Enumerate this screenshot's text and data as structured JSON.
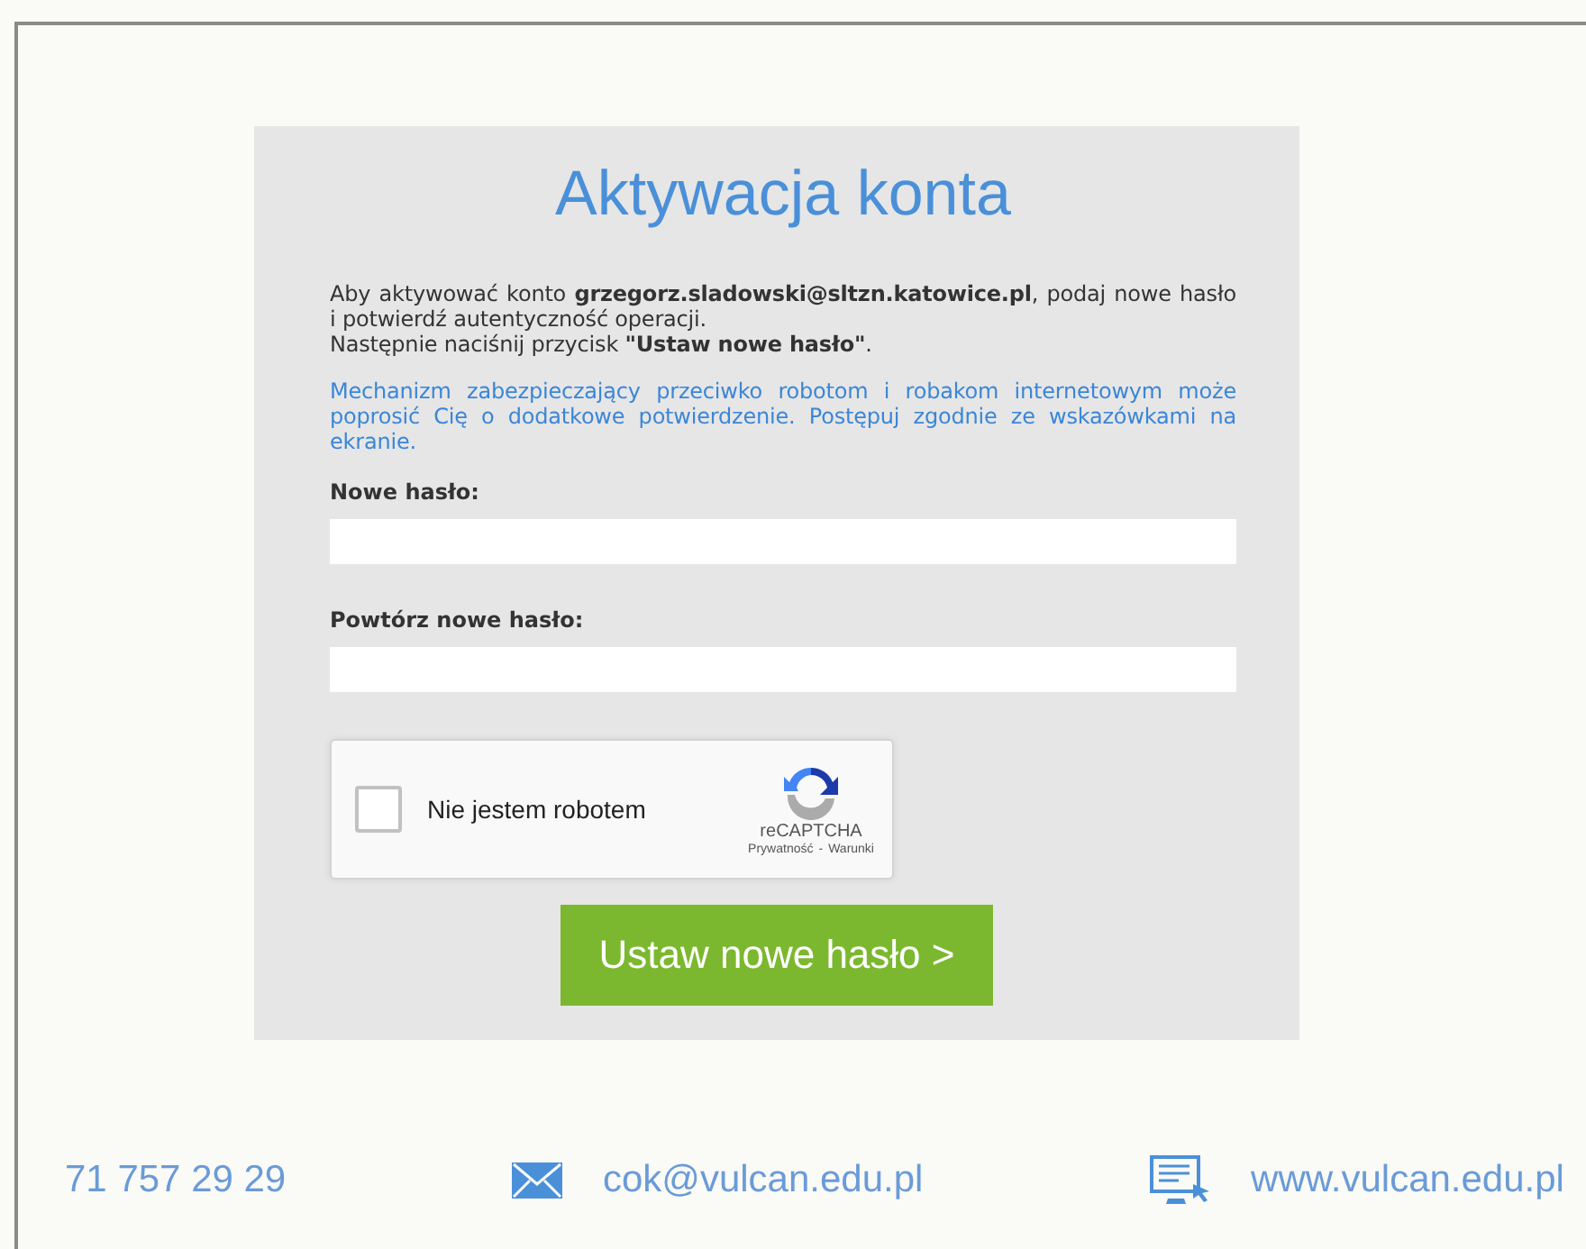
{
  "title": "Aktywacja konta",
  "intro": [
    "Aby aktywować konto **grzegorz.sladowski@sltzn.katowice.pl**, podaj nowe hasło i potwierdź autentyczność operacji.",
    "Następnie naciśnij przycisk **\"Ustaw nowe hasło\"**."
  ],
  "notice": "Mechanizm zabezpieczający przeciwko robotom i robakom internetowym może poprosić Cię o dodatkowe potwierdzenie. Postępuj zgodnie ze wskazówkami na ekranie.",
  "fields": [
    {
      "label": "Nowe hasło:"
    },
    {
      "label": "Powtórz nowe hasło:"
    }
  ],
  "captcha": {
    "label": "Nie jestem robotem",
    "checked": false,
    "brand": "reCAPTCHA",
    "privacy": "Prywatność",
    "separator": "-",
    "terms": "Warunki"
  },
  "submit": "Ustaw nowe hasło >",
  "footer": [
    {
      "kind": "phone",
      "text": "71 757 29 29"
    },
    {
      "kind": "email",
      "text": "cok@vulcan.edu.pl"
    },
    {
      "kind": "web",
      "text": "www.vulcan.edu.pl"
    }
  ]
}
